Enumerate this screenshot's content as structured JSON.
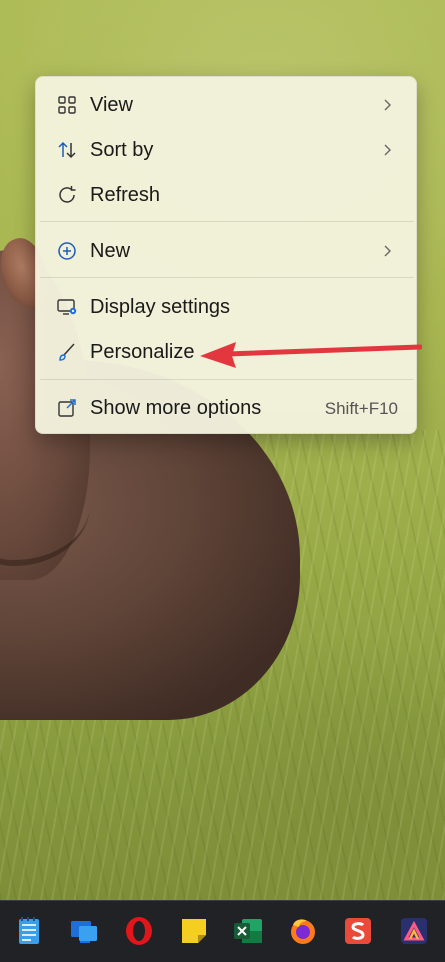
{
  "context_menu": {
    "items": [
      {
        "label": "View",
        "icon": "grid-view-icon",
        "has_submenu": true
      },
      {
        "label": "Sort by",
        "icon": "sort-arrows-icon",
        "has_submenu": true
      },
      {
        "label": "Refresh",
        "icon": "refresh-icon",
        "has_submenu": false
      },
      {
        "label": "New",
        "icon": "plus-circle-icon",
        "has_submenu": true
      },
      {
        "label": "Display settings",
        "icon": "display-settings-icon",
        "has_submenu": false
      },
      {
        "label": "Personalize",
        "icon": "brush-icon",
        "has_submenu": false
      },
      {
        "label": "Show more options",
        "icon": "open-external-icon",
        "has_submenu": false,
        "shortcut": "Shift+F10"
      }
    ]
  },
  "annotation": {
    "arrow_color": "#e2373f",
    "points_to": "Personalize"
  },
  "taskbar": {
    "apps": [
      {
        "icon": "notepad-icon",
        "color": "#3a9ee8"
      },
      {
        "icon": "windows-app-icon",
        "color": "#1e6fd9"
      },
      {
        "icon": "opera-icon",
        "color": "#e0161b"
      },
      {
        "icon": "sticky-notes-icon",
        "color": "#f4cf1f"
      },
      {
        "icon": "excel-icon",
        "color": "#1d7a44"
      },
      {
        "icon": "firefox-icon",
        "color": "#ff7a1a"
      },
      {
        "icon": "wps-office-icon",
        "color": "#ea4a3a"
      },
      {
        "icon": "affinity-icon",
        "color": "#2a2f6e"
      }
    ]
  },
  "wallpaper": {
    "subject": "hippo in grass",
    "colors": [
      "#a9b752",
      "#5e4337"
    ]
  }
}
